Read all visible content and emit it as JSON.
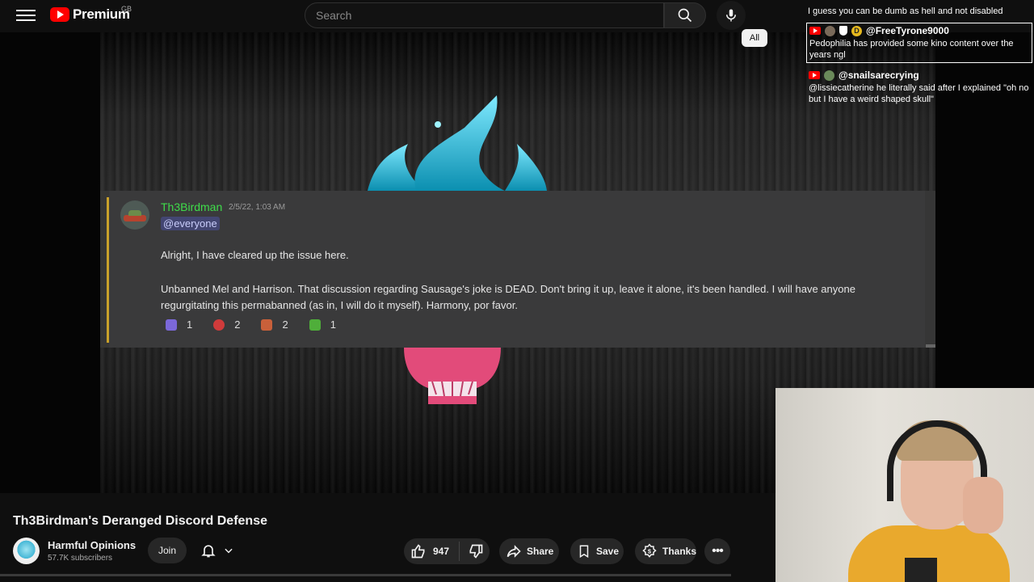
{
  "header": {
    "logo_text": "Premium",
    "region": "GB",
    "search_placeholder": "Search"
  },
  "video": {
    "discord_message": {
      "username": "Th3Birdman",
      "timestamp": "2/5/22, 1:03 AM",
      "mention": "@everyone",
      "line1": "Alright, I have cleared up the issue here.",
      "line2": "Unbanned Mel and Harrison. That discussion regarding Sausage's joke is DEAD. Don't bring it up, leave it alone, it's been handled. I will have anyone regurgitating this permabanned (as in, I will do it myself). Harmony, por favor.",
      "reactions": [
        {
          "count": "1",
          "color": "#7b68d9"
        },
        {
          "count": "2",
          "color": "#d03b3b"
        },
        {
          "count": "2",
          "color": "#c9603a"
        },
        {
          "count": "1",
          "color": "#4fae3a"
        }
      ]
    }
  },
  "chat": {
    "top_line": "I guess you can be dumb as hell and not disabled",
    "items": [
      {
        "author": "@FreeTyrone9000",
        "message": "Pedophilia has provided some kino content over the years ngl"
      },
      {
        "author": "@snailsarecrying",
        "message": "@lissiecatherine he literally said after I explained \"oh no but I have a weird shaped skull\""
      }
    ]
  },
  "video_info": {
    "title": "Th3Birdman's Deranged Discord Defense",
    "channel_name": "Harmful Opinions",
    "subscribers": "57.7K subscribers",
    "join_label": "Join",
    "like_count": "947",
    "share_label": "Share",
    "save_label": "Save",
    "thanks_label": "Thanks",
    "filter_chip": "All"
  },
  "icons": {
    "menu": "hamburger-icon",
    "search": "search-icon",
    "mic": "microphone-icon",
    "bell": "bell-icon",
    "like": "thumbs-up-icon",
    "dislike": "thumbs-down-icon",
    "share": "share-arrow-icon",
    "save": "bookmark-icon",
    "thanks": "thanks-icon",
    "more": "more-horizontal-icon"
  }
}
